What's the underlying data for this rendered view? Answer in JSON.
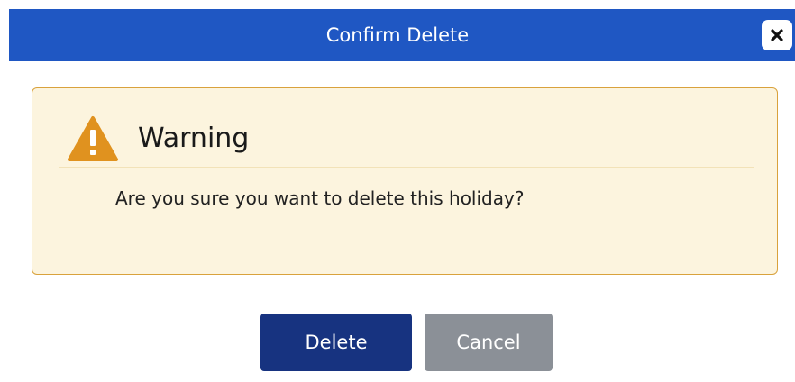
{
  "dialog": {
    "title": "Confirm Delete",
    "close_icon": "close-icon"
  },
  "warning": {
    "icon": "warning-icon",
    "heading": "Warning",
    "message": "Are you sure you want to delete this holiday?"
  },
  "actions": {
    "delete_label": "Delete",
    "cancel_label": "Cancel"
  },
  "colors": {
    "titlebar": "#1f57c3",
    "warning_background": "#fcf4de",
    "warning_border": "#d9a23c",
    "warning_icon": "#e0921f",
    "delete_button": "#173380",
    "cancel_button": "#8b9097"
  }
}
